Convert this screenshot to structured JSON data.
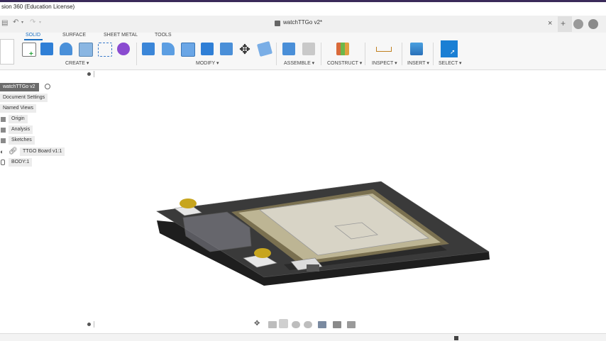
{
  "window": {
    "title": "sion 360 (Education License)"
  },
  "document": {
    "tab_title": "watchTTGo v2*",
    "close_glyph": "×"
  },
  "workspace_tabs": [
    "SOLID",
    "SURFACE",
    "SHEET METAL",
    "TOOLS"
  ],
  "groups": {
    "create": "CREATE ▾",
    "modify": "MODIFY ▾",
    "assemble": "ASSEMBLE ▾",
    "construct": "CONSTRUCT ▾",
    "inspect": "INSPECT ▾",
    "insert": "INSERT ▾",
    "select": "SELECT ▾"
  },
  "browser": {
    "root": "watchTTGo v2",
    "items": [
      "Document Settings",
      "Named Views",
      "Origin",
      "Analysis",
      "Sketches",
      "TTGO Board v1:1",
      "BODY:1"
    ]
  },
  "colors": {
    "accent": "#1b6fc2",
    "board": "#2b2b2b",
    "screen": "#c9c1a4"
  }
}
